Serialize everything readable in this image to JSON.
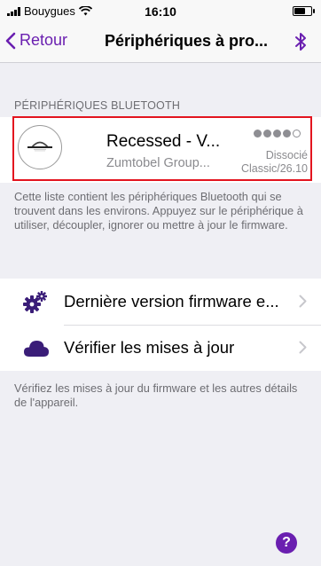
{
  "status_bar": {
    "carrier": "Bouygues",
    "time": "16:10",
    "icons": [
      "signal-icon",
      "wifi-icon",
      "battery-icon"
    ]
  },
  "nav": {
    "back_label": "Retour",
    "title": "Périphériques à pro...",
    "right_icon": "bluetooth-icon"
  },
  "bluetooth_section": {
    "header": "PÉRIPHÉRIQUES BLUETOOTH",
    "device": {
      "name": "Recessed - V...",
      "vendor": "Zumtobel Group...",
      "status": "Dissocié",
      "firmware": "Classic/26.10",
      "signal_strength": 4,
      "signal_max": 5
    },
    "description": "Cette liste contient les périphériques Bluetooth qui se trouvent dans les environs. Appuyez sur le périphérique à utiliser, découpler, ignorer ou mettre à jour le firmware."
  },
  "menu": [
    {
      "label": "Dernière version firmware e...",
      "icon": "gears-icon"
    },
    {
      "label": "Vérifier les mises à jour",
      "icon": "cloud-icon"
    }
  ],
  "footer_description": "Vérifiez les mises à jour du firmware et les autres détails de l'appareil.",
  "help": {
    "label": "?"
  },
  "colors": {
    "accent": "#6a1fb0",
    "highlight": "#e3141f"
  }
}
